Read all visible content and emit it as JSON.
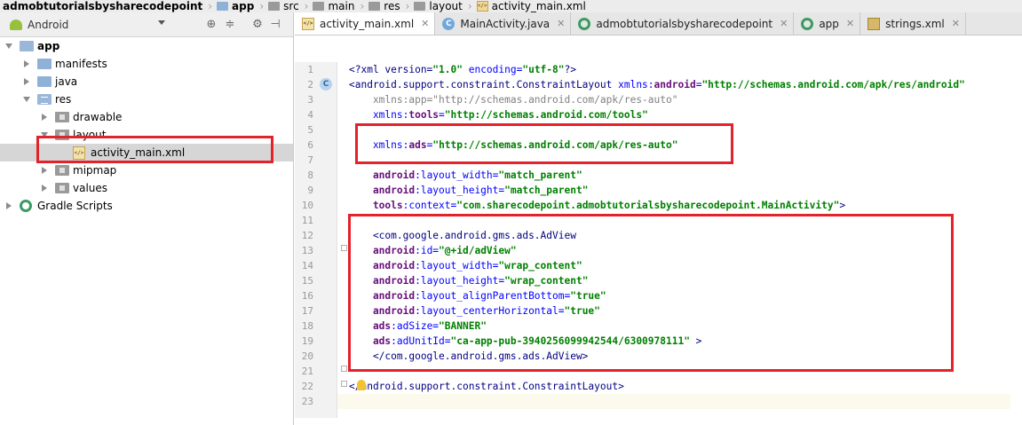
{
  "breadcrumb": [
    {
      "label": "admobtutorialsbysharecodepoint",
      "bold": true
    },
    {
      "label": "app",
      "bold": true
    },
    {
      "label": "src"
    },
    {
      "label": "main"
    },
    {
      "label": "res"
    },
    {
      "label": "layout"
    },
    {
      "label": "activity_main.xml"
    }
  ],
  "project_panel": {
    "view": "Android",
    "toolbar_icons": [
      "sync-target-icon",
      "collapse-all-icon",
      "settings-gear-icon",
      "hide-panel-icon"
    ]
  },
  "tree": [
    {
      "label": "app",
      "bold": true,
      "expanded": true,
      "icon": "module-folder-icon"
    },
    {
      "label": "manifests",
      "expanded": false,
      "icon": "folder-icon"
    },
    {
      "label": "java",
      "expanded": false,
      "icon": "folder-icon"
    },
    {
      "label": "res",
      "expanded": true,
      "icon": "res-folder-icon"
    },
    {
      "label": "drawable",
      "expanded": false,
      "icon": "package-folder-icon"
    },
    {
      "label": "layout",
      "expanded": true,
      "icon": "package-folder-icon"
    },
    {
      "label": "activity_main.xml",
      "selected": true,
      "icon": "xml-file-icon"
    },
    {
      "label": "mipmap",
      "expanded": false,
      "icon": "package-folder-icon"
    },
    {
      "label": "values",
      "expanded": false,
      "icon": "package-folder-icon"
    },
    {
      "label": "Gradle Scripts",
      "expanded": false,
      "icon": "gradle-icon"
    }
  ],
  "tabs": [
    {
      "label": "activity_main.xml",
      "active": true,
      "icon": "xml-file-icon"
    },
    {
      "label": "MainActivity.java",
      "icon": "java-class-icon"
    },
    {
      "label": "admobtutorialsbysharecodepoint",
      "icon": "run-config-icon"
    },
    {
      "label": "app",
      "icon": "run-config-icon"
    },
    {
      "label": "strings.xml",
      "icon": "values-xml-icon"
    }
  ],
  "code": {
    "line_numbers": [
      "1",
      "2",
      "3",
      "4",
      "5",
      "6",
      "7",
      "8",
      "9",
      "10",
      "11",
      "12",
      "13",
      "14",
      "15",
      "16",
      "17",
      "18",
      "19",
      "20",
      "21",
      "22",
      "23"
    ],
    "lines": {
      "l1_a": "<?xml version=",
      "l1_b": "\"1.0\"",
      "l1_c": " encoding=",
      "l1_d": "\"utf-8\"",
      "l1_e": "?>",
      "l2_a": "<android.support.constraint.ConstraintLayout ",
      "l2_b": "xmlns:",
      "l2_c": "android",
      "l2_d": "=",
      "l2_e": "\"http://schemas.android.com/apk/res/android\"",
      "l3_a": "    xmlns:app=",
      "l3_b": "\"http://schemas.android.com/apk/res-auto\"",
      "l4_a": "    xmlns:",
      "l4_b": "tools",
      "l4_c": "=",
      "l4_d": "\"http://schemas.android.com/tools\"",
      "l6_a": "    xmlns:",
      "l6_b": "ads",
      "l6_c": "=",
      "l6_d": "\"http://schemas.android.com/apk/res-auto\"",
      "l8_a": "    android",
      "l8_b": ":layout_width=",
      "l8_c": "\"match_parent\"",
      "l9_a": "    android",
      "l9_b": ":layout_height=",
      "l9_c": "\"match_parent\"",
      "l10_a": "    tools",
      "l10_b": ":context=",
      "l10_c": "\"com.sharecodepoint.admobtutorialsbysharecodepoint.MainActivity\"",
      "l10_d": ">",
      "l12_a": "    <com.google.android.gms.ads.AdView",
      "l13_a": "    android",
      "l13_b": ":id=",
      "l13_c": "\"@+id/adView\"",
      "l14_a": "    android",
      "l14_b": ":layout_width=",
      "l14_c": "\"wrap_content\"",
      "l15_a": "    android",
      "l15_b": ":layout_height=",
      "l15_c": "\"wrap_content\"",
      "l16_a": "    android",
      "l16_b": ":layout_alignParentBottom=",
      "l16_c": "\"true\"",
      "l17_a": "    android",
      "l17_b": ":layout_centerHorizontal=",
      "l17_c": "\"true\"",
      "l18_a": "    ads",
      "l18_b": ":adSize=",
      "l18_c": "\"BANNER\"",
      "l19_a": "    ads",
      "l19_b": ":adUnitId=",
      "l19_c": "\"ca-app-pub-3940256099942544/6300978111\"",
      "l19_d": " >",
      "l20_a": "    </com.google.android.gms.ads.AdView>",
      "l22_a": "</android.support.constraint.ConstraintLayout>"
    },
    "gutter_class_marker": "C"
  },
  "colors": {
    "highlight": "#e3222b",
    "tag": "#000080",
    "namespace": "#660e7a",
    "attribute": "#0000ff",
    "string": "#008000"
  }
}
